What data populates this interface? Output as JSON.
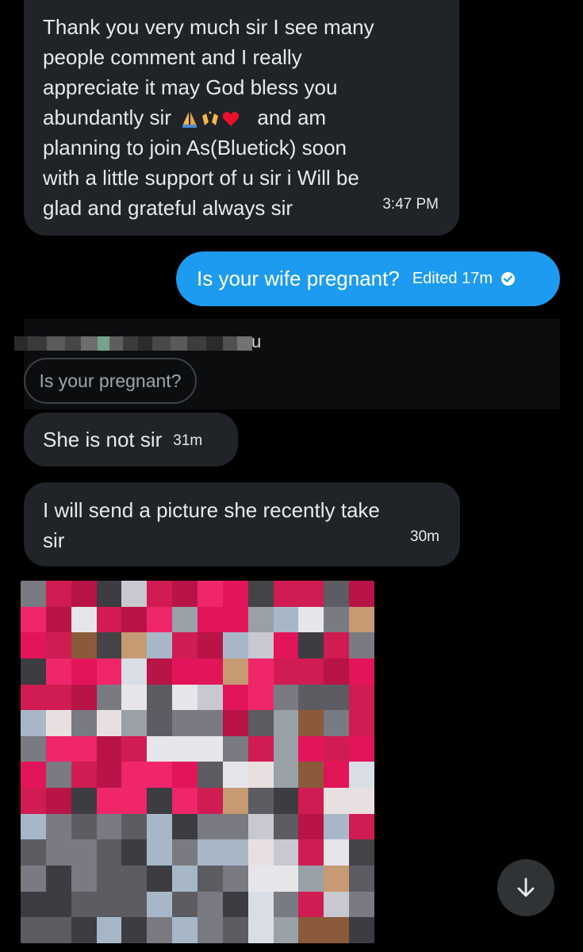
{
  "messages": {
    "m1": {
      "lines": [
        "Thank you very much sir I see many",
        "people comment and I really",
        "appreciate it may God bless you",
        "abundantly sir",
        "and am",
        "planning to join As(Bluetick) soon",
        "with a little support of u sir i Will be",
        "glad and grateful always sir"
      ],
      "emojis": [
        "pray-icon",
        "raising-hands-icon",
        "heart-icon"
      ],
      "time": "3:47 PM"
    },
    "sent": {
      "text": "Is your wife pregnant?",
      "edited": "Edited 17m",
      "icon": "check-circle-icon"
    },
    "reply": {
      "partial_text": "u",
      "quoted": "Is your pregnant?"
    },
    "m2": {
      "text": "She is not sir",
      "time": "31m"
    },
    "m3": {
      "lines": [
        "I will send a picture she recently take",
        "sir"
      ],
      "time": "30m"
    }
  },
  "colors": {
    "background": "#000000",
    "received_bubble": "#202327",
    "sent_bubble": "#1d9bf0",
    "text": "#e7e9ea"
  },
  "scroll_button": {
    "icon": "arrow-down-icon"
  }
}
